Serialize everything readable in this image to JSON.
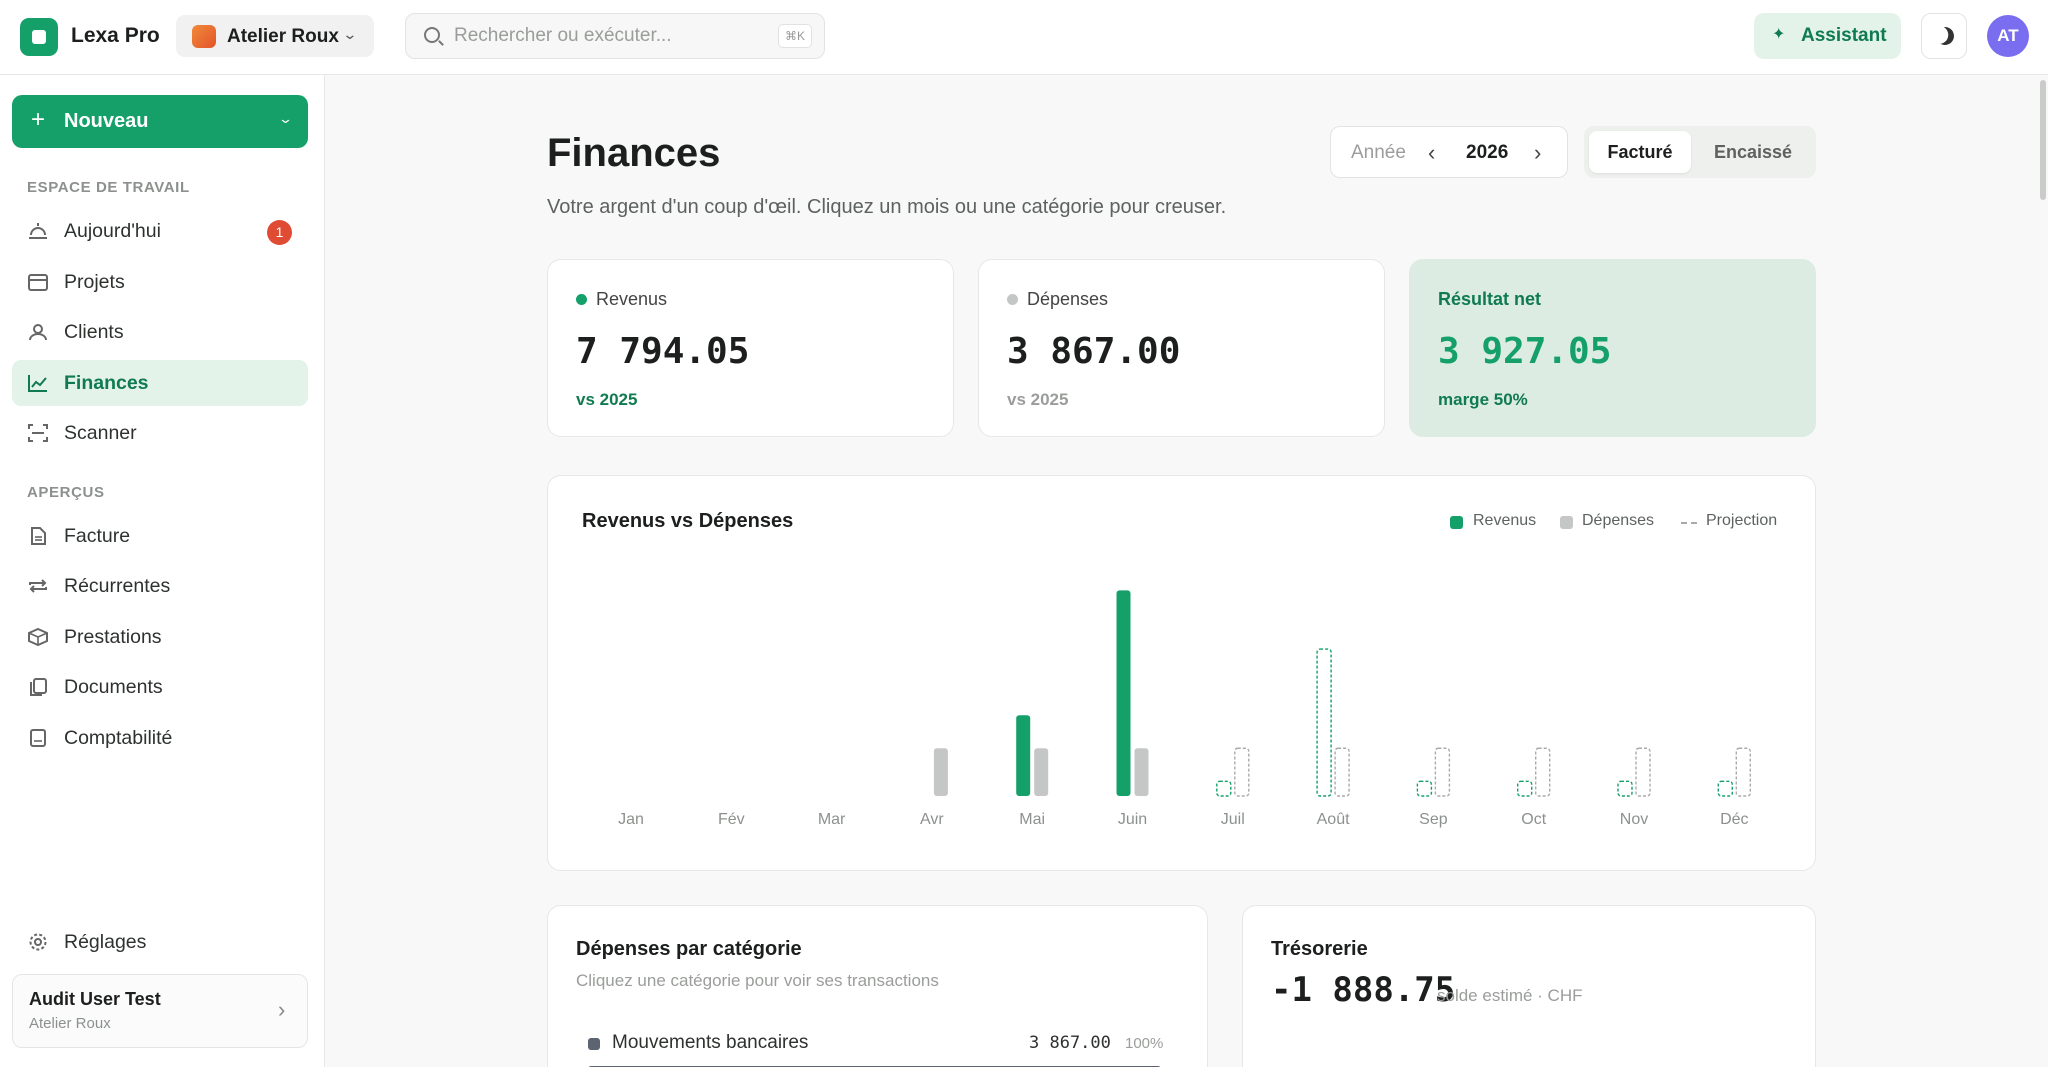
{
  "app": {
    "name": "Lexa Pro"
  },
  "workspace": {
    "name": "Atelier Roux"
  },
  "search": {
    "placeholder": "Rechercher ou exécuter...",
    "shortcut": "⌘K"
  },
  "header": {
    "assistant_label": "Assistant",
    "avatar_initials": "AT"
  },
  "sidebar": {
    "new_label": "Nouveau",
    "section_workspace": "ESPACE DE TRAVAIL",
    "section_overviews": "APERÇUS",
    "items": [
      {
        "label": "Aujourd'hui",
        "badge": "1"
      },
      {
        "label": "Projets"
      },
      {
        "label": "Clients"
      },
      {
        "label": "Finances"
      },
      {
        "label": "Scanner"
      },
      {
        "label": "Facture"
      },
      {
        "label": "Récurrentes"
      },
      {
        "label": "Prestations"
      },
      {
        "label": "Documents"
      },
      {
        "label": "Comptabilité"
      }
    ],
    "settings_label": "Réglages",
    "user": {
      "name": "Audit User Test",
      "org": "Atelier Roux"
    }
  },
  "page": {
    "title": "Finances",
    "subtitle": "Votre argent d'un coup d'œil. Cliquez un mois ou une catégorie pour creuser.",
    "year_label": "Année",
    "year": "2026",
    "toggle": [
      "Facturé",
      "Encaissé"
    ],
    "toggle_selected": "Facturé"
  },
  "kpis": {
    "revenue": {
      "label": "Revenus",
      "value": "7 794.05",
      "note": "vs 2025",
      "dot_color": "#15a06a"
    },
    "expenses": {
      "label": "Dépenses",
      "value": "3 867.00",
      "note": "vs 2025",
      "dot_color": "#c4c7c5"
    },
    "net": {
      "label": "Résultat net",
      "value": "3 927.05",
      "note": "marge 50%"
    }
  },
  "chart": {
    "title": "Revenus vs Dépenses",
    "legend": [
      "Revenus",
      "Dépenses",
      "Projection"
    ]
  },
  "chart_data": {
    "type": "bar",
    "categories": [
      "Jan",
      "Fév",
      "Mar",
      "Avr",
      "Mai",
      "Juin",
      "Juil",
      "Août",
      "Sep",
      "Oct",
      "Nov",
      "Déc"
    ],
    "series": [
      {
        "name": "Revenus",
        "values": [
          0,
          0,
          0,
          0,
          2200,
          5600,
          null,
          null,
          null,
          null,
          null,
          null
        ]
      },
      {
        "name": "Dépenses",
        "values": [
          0,
          0,
          0,
          1300,
          1300,
          1300,
          null,
          null,
          null,
          null,
          null,
          null
        ]
      },
      {
        "name": "Projection",
        "values": [
          null,
          null,
          null,
          null,
          null,
          null,
          400,
          4000,
          400,
          400,
          400,
          400
        ]
      },
      {
        "name": "Projection",
        "values": [
          null,
          null,
          null,
          null,
          null,
          null,
          1300,
          1300,
          1300,
          1300,
          1300,
          1300
        ]
      }
    ],
    "colors": {
      "revenue": "#15a06a",
      "expenses": "#c4c7c5",
      "projection": "#aaaaaa"
    },
    "ylim": [
      0,
      5800
    ],
    "grid": false,
    "legend_position": "top-right"
  },
  "categories": {
    "title": "Dépenses par catégorie",
    "subtitle": "Cliquez une catégorie pour voir ses transactions",
    "items": [
      {
        "name": "Mouvements bancaires",
        "amount": "3 867.00",
        "percent": "100%"
      }
    ]
  },
  "treasury": {
    "title": "Trésorerie",
    "value": "-1 888.75",
    "note": "solde estimé · CHF"
  }
}
